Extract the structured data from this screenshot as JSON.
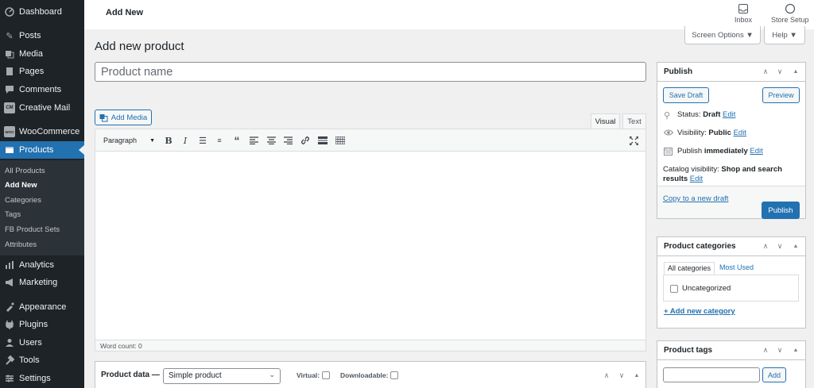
{
  "sidebar": {
    "menu": [
      {
        "label": "Dashboard",
        "icon": "dashboard-icon"
      },
      {
        "label": "Posts",
        "icon": "pin-icon"
      },
      {
        "label": "Media",
        "icon": "media-icon"
      },
      {
        "label": "Pages",
        "icon": "pages-icon"
      },
      {
        "label": "Comments",
        "icon": "comments-icon"
      },
      {
        "label": "Creative Mail",
        "icon": "cm-icon",
        "badge": "CM"
      },
      {
        "label": "WooCommerce",
        "icon": "woo-icon",
        "badge": "WOO"
      },
      {
        "label": "Products",
        "icon": "products-icon",
        "active": true
      },
      {
        "label": "Analytics",
        "icon": "analytics-icon"
      },
      {
        "label": "Marketing",
        "icon": "marketing-icon"
      },
      {
        "label": "Appearance",
        "icon": "appearance-icon"
      },
      {
        "label": "Plugins",
        "icon": "plugins-icon"
      },
      {
        "label": "Users",
        "icon": "users-icon"
      },
      {
        "label": "Tools",
        "icon": "tools-icon"
      },
      {
        "label": "Settings",
        "icon": "settings-icon"
      }
    ],
    "submenu": [
      {
        "label": "All Products"
      },
      {
        "label": "Add New",
        "current": true
      },
      {
        "label": "Categories"
      },
      {
        "label": "Tags"
      },
      {
        "label": "FB Product Sets"
      },
      {
        "label": "Attributes"
      }
    ]
  },
  "header": {
    "title": "Add New",
    "inbox_label": "Inbox",
    "store_setup_label": "Store Setup"
  },
  "screen_options_label": "Screen Options ▼",
  "help_label": "Help ▼",
  "page_title": "Add new product",
  "product_name_placeholder": "Product name",
  "editor": {
    "add_media_label": "Add Media",
    "tab_visual": "Visual",
    "tab_text": "Text",
    "format_value": "Paragraph",
    "word_count": "Word count: 0"
  },
  "product_data": {
    "label": "Product data —",
    "type_value": "Simple product",
    "virtual_label": "Virtual:",
    "downloadable_label": "Downloadable:"
  },
  "publish_box": {
    "title": "Publish",
    "save_draft": "Save Draft",
    "preview": "Preview",
    "status_label": "Status:",
    "status_value": "Draft",
    "visibility_label": "Visibility:",
    "visibility_value": "Public",
    "publish_label": "Publish",
    "publish_value": "immediately",
    "catalog_label": "Catalog visibility:",
    "catalog_value": "Shop and search results",
    "edit_link": "Edit",
    "copy_link": "Copy to a new draft",
    "publish_button": "Publish"
  },
  "categories_box": {
    "title": "Product categories",
    "tab_all": "All categories",
    "tab_most_used": "Most Used",
    "items": [
      "Uncategorized"
    ],
    "add_new_link": "+ Add new category"
  },
  "tags_box": {
    "title": "Product tags",
    "add_button": "Add"
  },
  "colors": {
    "accent": "#2271b1",
    "sidebar_bg": "#1d2327",
    "submenu_bg": "#2c3338"
  }
}
